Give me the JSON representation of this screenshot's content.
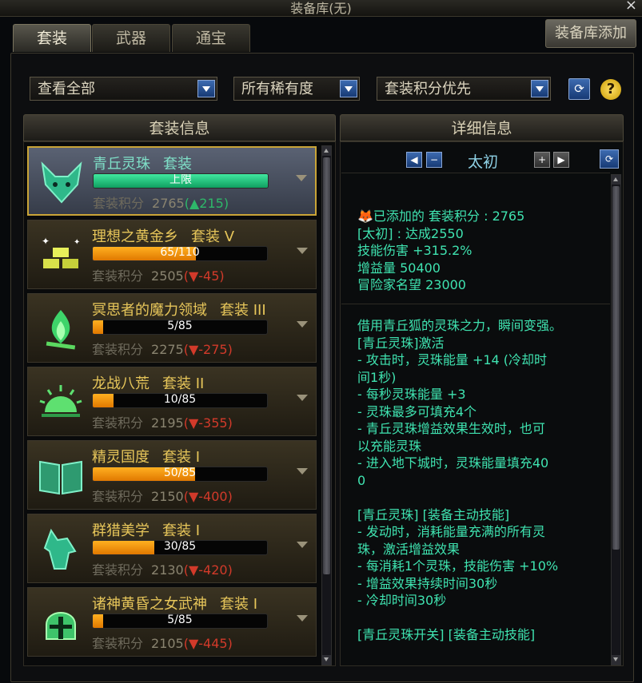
{
  "window": {
    "title": "装备库(无)",
    "close": "×"
  },
  "tabs": [
    {
      "label": "套装",
      "active": true
    },
    {
      "label": "武器",
      "active": false
    },
    {
      "label": "通宝",
      "active": false
    }
  ],
  "add_button": "装备库添加",
  "filters": {
    "view": "查看全部",
    "rarity": "所有稀有度",
    "sort": "套装积分优先",
    "help": "?"
  },
  "set_panel": {
    "header": "套装信息"
  },
  "detail_panel": {
    "header": "详细信息",
    "level": "太初"
  },
  "sets": [
    {
      "name": "青丘灵珠",
      "suffix": "套装",
      "bar_text": "上限",
      "progress": 1.0,
      "score_label": "套装积分",
      "score": "2765",
      "delta": "(▲215)",
      "delta_up": true,
      "icon": "fox-icon",
      "selected": true
    },
    {
      "name": "理想之黄金乡",
      "suffix": "套装 V",
      "bar_text": "65/110",
      "progress": 0.591,
      "score_label": "套装积分",
      "score": "2505",
      "delta": "(▼-45)",
      "delta_up": false,
      "icon": "gold-bars-icon",
      "selected": false
    },
    {
      "name": "冥思者的魔力领域",
      "suffix": "套装 III",
      "bar_text": "5/85",
      "progress": 0.059,
      "score_label": "套装积分",
      "score": "2275",
      "delta": "(▼-275)",
      "delta_up": false,
      "icon": "campfire-icon",
      "selected": false
    },
    {
      "name": "龙战八荒",
      "suffix": "套装 II",
      "bar_text": "10/85",
      "progress": 0.118,
      "score_label": "套装积分",
      "score": "2195",
      "delta": "(▼-355)",
      "delta_up": false,
      "icon": "sunrise-icon",
      "selected": false
    },
    {
      "name": "精灵国度",
      "suffix": "套装 I",
      "bar_text": "50/85",
      "progress": 0.588,
      "score_label": "套装积分",
      "score": "2150",
      "delta": "(▼-400)",
      "delta_up": false,
      "icon": "book-icon",
      "selected": false
    },
    {
      "name": "群猎美学",
      "suffix": "套装 I",
      "bar_text": "30/85",
      "progress": 0.353,
      "score_label": "套装积分",
      "score": "2130",
      "delta": "(▼-420)",
      "delta_up": false,
      "icon": "wolf-icon",
      "selected": false
    },
    {
      "name": "诸神黄昏之女武神",
      "suffix": "套装 I",
      "bar_text": "5/85",
      "progress": 0.059,
      "score_label": "套装积分",
      "score": "2105",
      "delta": "(▼-445)",
      "delta_up": false,
      "icon": "helmet-icon",
      "selected": false
    }
  ],
  "details": {
    "stats": [
      "已添加的 套装积分 : 2765",
      "[太初] : 达成2550",
      "技能伤害 +315.2%",
      "增益量 50400",
      "冒险家名望 23000"
    ],
    "description": [
      "借用青丘狐的灵珠之力，瞬间变强。",
      "[青丘灵珠]激活",
      "- 攻击时，灵珠能量 +14 (冷却时",
      "间1秒)",
      "- 每秒灵珠能量 +3",
      "- 灵珠最多可填充4个",
      "- 青丘灵珠增益效果生效时，也可",
      "以充能灵珠",
      "- 进入地下城时，灵珠能量填充40",
      "0",
      "",
      "[青丘灵珠] [装备主动技能]",
      "- 发动时，消耗能量充满的所有灵",
      "珠，激活增益效果",
      "- 每消耗1个灵珠，技能伤害 +10%",
      "- 增益效果持续时间30秒",
      "- 冷却时间30秒",
      "",
      "[青丘灵珠开关] [装备主动技能]"
    ]
  },
  "colors": {
    "accent_gold": "#c9a437",
    "text_green": "#3fe3b0",
    "bar_orange": "#ffb020",
    "bar_green": "#40e8a0",
    "delta_down": "#d23a2a",
    "delta_up": "#2eb86a"
  }
}
